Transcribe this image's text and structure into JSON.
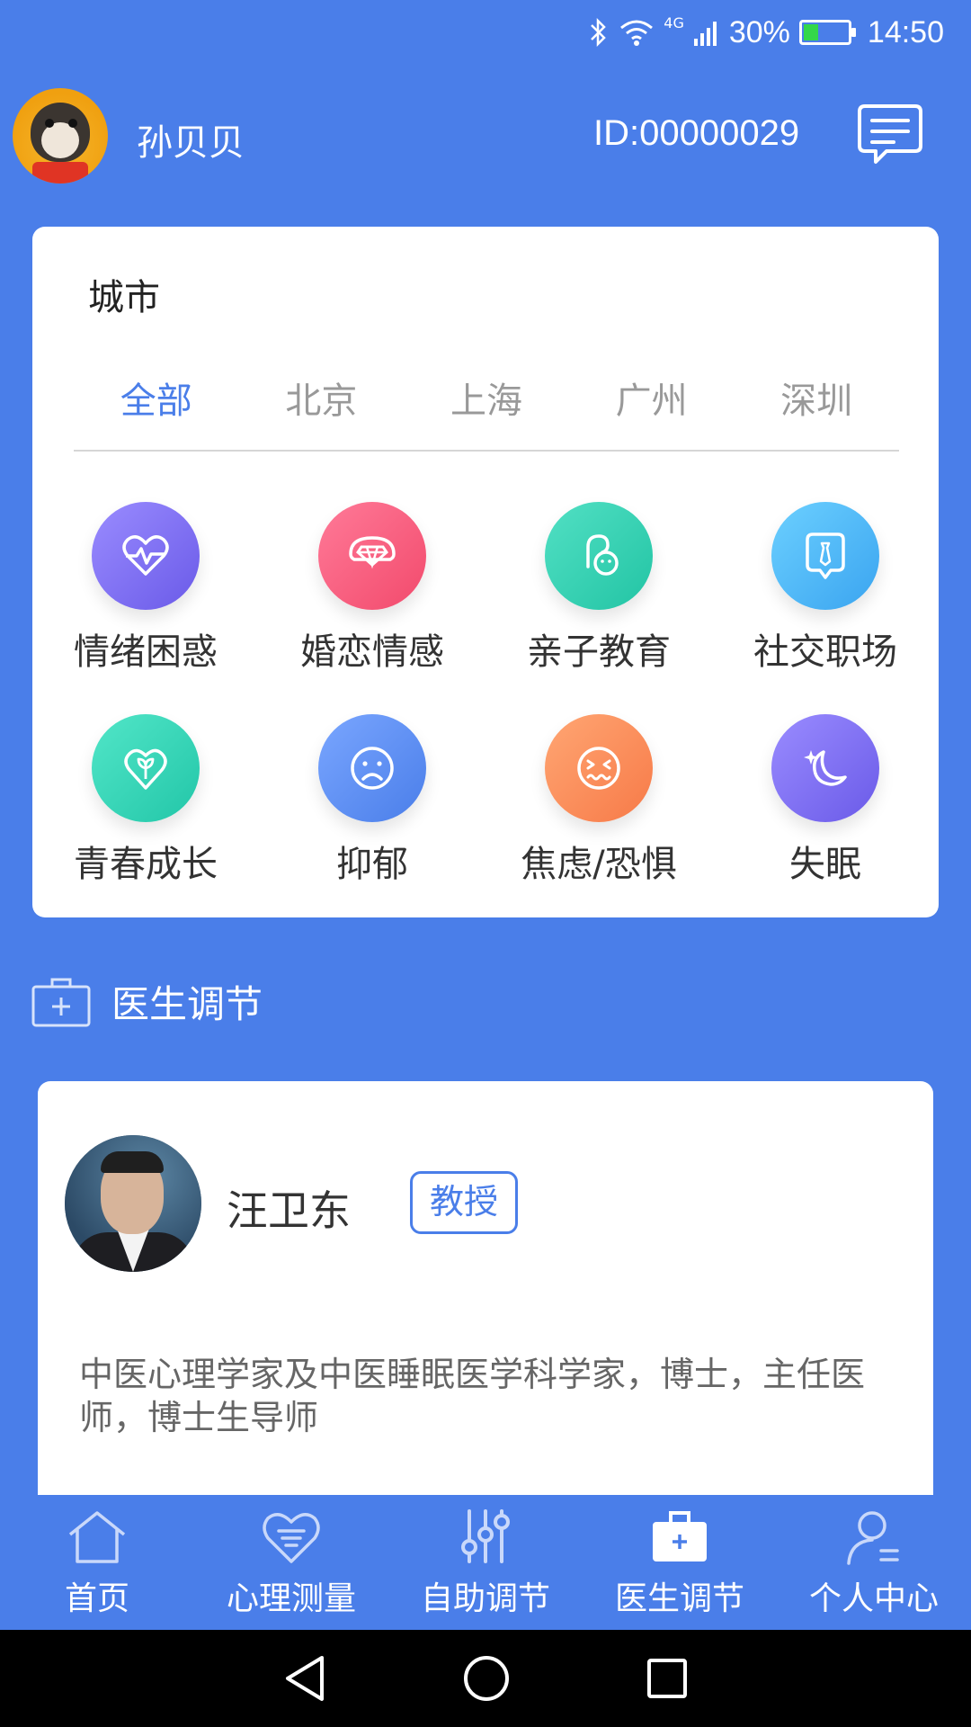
{
  "status_bar": {
    "network": "4G",
    "battery": "30%",
    "time": "14:50"
  },
  "header": {
    "username": "孙贝贝",
    "user_id": "ID:00000029"
  },
  "city": {
    "title": "城市",
    "tabs": [
      "全部",
      "北京",
      "上海",
      "广州",
      "深圳"
    ],
    "active_tab": "全部"
  },
  "categories": [
    {
      "label": "情绪困惑",
      "icon": "heartbeat-icon",
      "color": "#7a6cf0"
    },
    {
      "label": "婚恋情感",
      "icon": "diamond-icon",
      "color": "#f5557a"
    },
    {
      "label": "亲子教育",
      "icon": "baby-icon",
      "color": "#2ecfb2"
    },
    {
      "label": "社交职场",
      "icon": "tie-icon",
      "color": "#4ab4f4"
    },
    {
      "label": "青春成长",
      "icon": "sprout-icon",
      "color": "#2ed5b5"
    },
    {
      "label": "抑郁",
      "icon": "sad-face-icon",
      "color": "#5f8ff0"
    },
    {
      "label": "焦虑/恐惧",
      "icon": "anxious-face-icon",
      "color": "#fa8a5a"
    },
    {
      "label": "失眠",
      "icon": "moon-icon",
      "color": "#7a6cf0"
    }
  ],
  "section": {
    "title": "医生调节"
  },
  "doctor": {
    "name": "汪卫东",
    "tag": "教授",
    "description": "中医心理学家及中医睡眠医学科学家，博士，主任医师，博士生导师"
  },
  "bottom_nav": [
    {
      "label": "首页",
      "icon": "home-icon"
    },
    {
      "label": "心理测量",
      "icon": "heart-list-icon"
    },
    {
      "label": "自助调节",
      "icon": "sliders-icon"
    },
    {
      "label": "医生调节",
      "icon": "medical-kit-icon"
    },
    {
      "label": "个人中心",
      "icon": "person-icon"
    }
  ],
  "colors": {
    "primary": "#4a7ee9",
    "card": "#ffffff"
  }
}
